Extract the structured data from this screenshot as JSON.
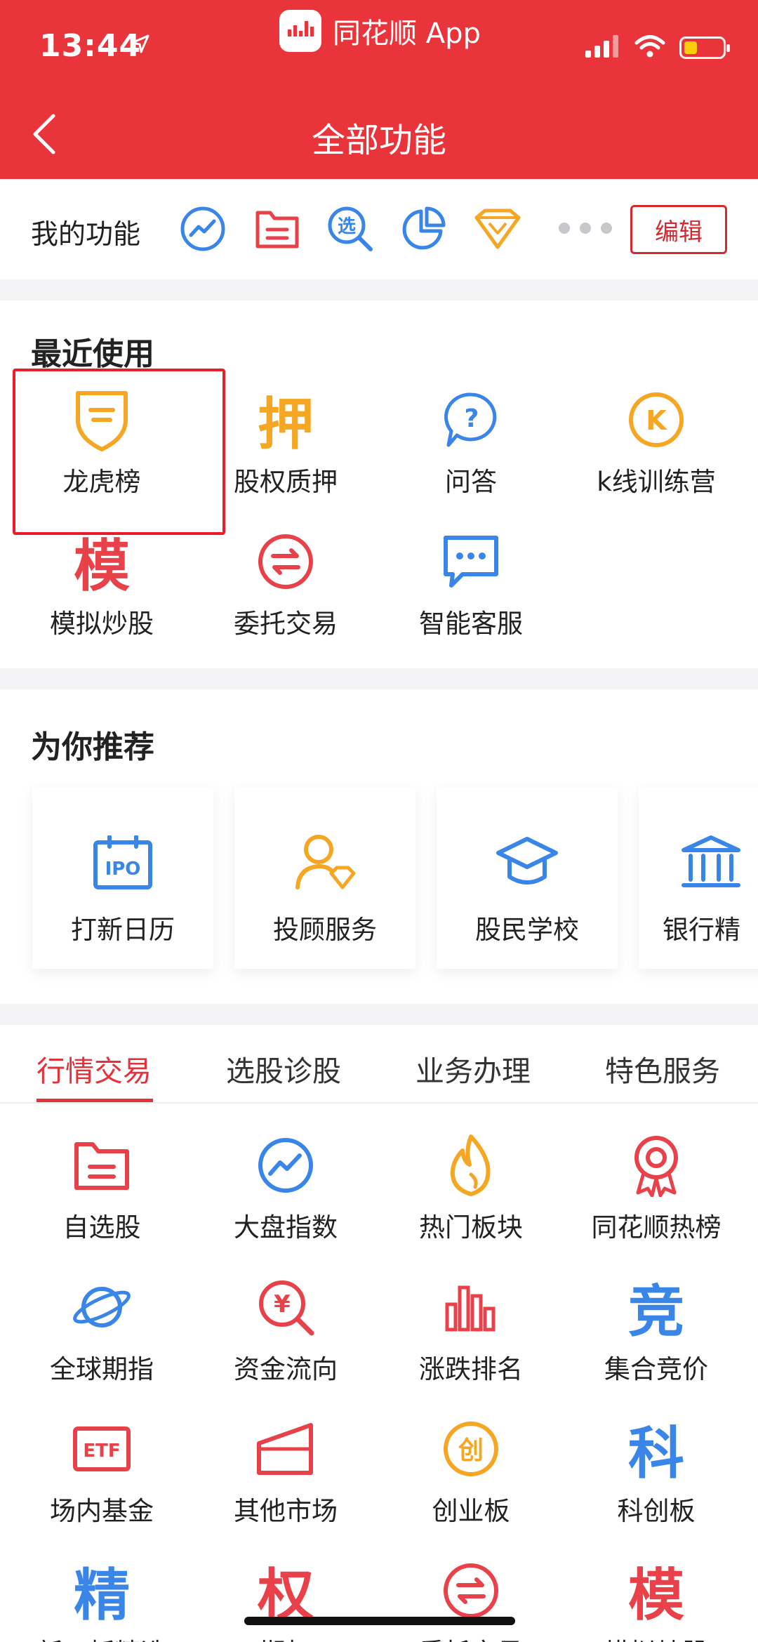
{
  "status_bar": {
    "time": "13:44",
    "app_name": "同花顺 App"
  },
  "header": {
    "title": "全部功能"
  },
  "my_functions": {
    "label": "我的功能",
    "icons": [
      "trend-chart-icon",
      "folder-list-icon",
      "stock-select-icon",
      "pie-chart-icon",
      "diamond-icon"
    ],
    "edit_label": "编辑"
  },
  "recent": {
    "title": "最近使用",
    "items": [
      {
        "label": "龙虎榜",
        "icon": "shield-icon"
      },
      {
        "label": "股权质押",
        "icon": "pledge-icon",
        "glyph": "押"
      },
      {
        "label": "问答",
        "icon": "question-bubble-icon",
        "glyph": "?"
      },
      {
        "label": "k线训练营",
        "icon": "k-coin-icon",
        "glyph": "K"
      },
      {
        "label": "模拟炒股",
        "icon": "simulate-icon",
        "glyph": "模"
      },
      {
        "label": "委托交易",
        "icon": "exchange-icon"
      },
      {
        "label": "智能客服",
        "icon": "chat-icon"
      }
    ]
  },
  "recommend": {
    "title": "为你推荐",
    "items": [
      {
        "label": "打新日历",
        "icon": "ipo-calendar-icon",
        "glyph": "IPO"
      },
      {
        "label": "投顾服务",
        "icon": "advisor-icon"
      },
      {
        "label": "股民学校",
        "icon": "graduation-cap-icon"
      },
      {
        "label": "银行精",
        "icon": "bank-icon"
      }
    ]
  },
  "tabs": {
    "items": [
      "行情交易",
      "选股诊股",
      "业务办理",
      "特色服务"
    ],
    "active": 0
  },
  "market_grid": [
    {
      "label": "自选股",
      "icon": "folder-list-icon"
    },
    {
      "label": "大盘指数",
      "icon": "trend-chart-icon"
    },
    {
      "label": "热门板块",
      "icon": "flame-icon"
    },
    {
      "label": "同花顺热榜",
      "icon": "medal-icon"
    },
    {
      "label": "全球期指",
      "icon": "planet-icon"
    },
    {
      "label": "资金流向",
      "icon": "money-search-icon",
      "glyph": "¥"
    },
    {
      "label": "涨跌排名",
      "icon": "bar-chart-icon"
    },
    {
      "label": "集合竞价",
      "icon": "bid-icon",
      "glyph": "竞"
    },
    {
      "label": "场内基金",
      "icon": "etf-icon",
      "glyph": "ETF"
    },
    {
      "label": "其他市场",
      "icon": "other-market-icon"
    },
    {
      "label": "创业板",
      "icon": "chuang-coin-icon",
      "glyph": "创"
    },
    {
      "label": "科创板",
      "icon": "ke-icon",
      "glyph": "科"
    },
    {
      "label": "新三板精选",
      "icon": "jing-icon",
      "glyph": "精"
    },
    {
      "label": "期权",
      "icon": "quan-icon",
      "glyph": "权"
    },
    {
      "label": "委托交易",
      "icon": "exchange-icon"
    },
    {
      "label": "模拟炒股",
      "icon": "simulate-icon",
      "glyph": "模"
    }
  ]
}
